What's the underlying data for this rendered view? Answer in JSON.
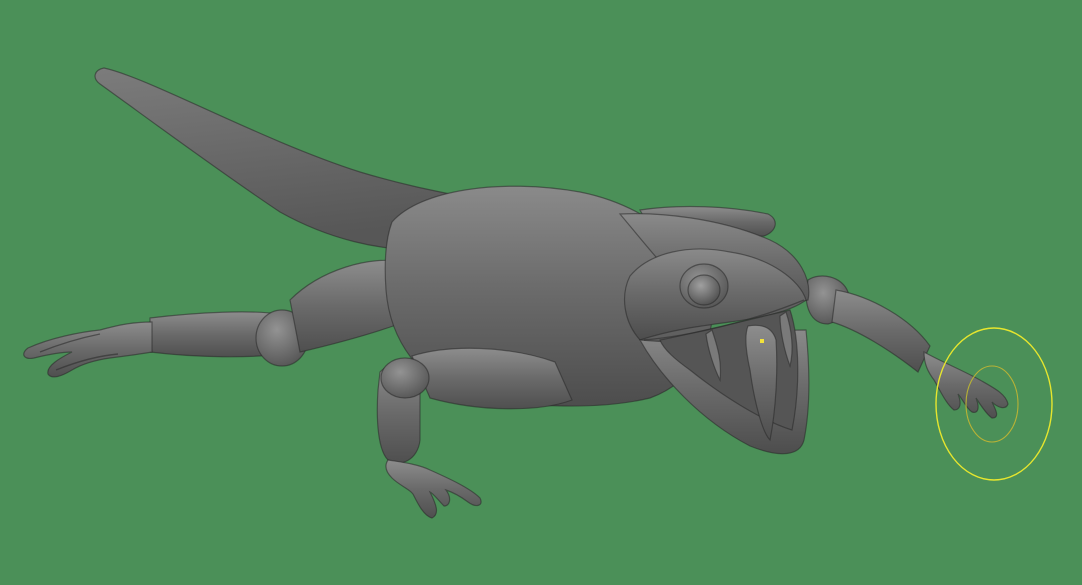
{
  "viewport": {
    "background_color": "#4b9058",
    "model_base_color": "#6a6a6a",
    "model_shadow_color": "#4a4a4a",
    "model_highlight_color": "#8c8c8c",
    "mouth_interior_color": "#555555"
  },
  "brush": {
    "outer_ring_color": "#e6e62e",
    "inner_ring_color": "#b8b236",
    "pivot_color": "#f2e23a",
    "icon": "sculpt-brush-cursor"
  },
  "model": {
    "subject": "lizard-sculpt-mesh"
  }
}
